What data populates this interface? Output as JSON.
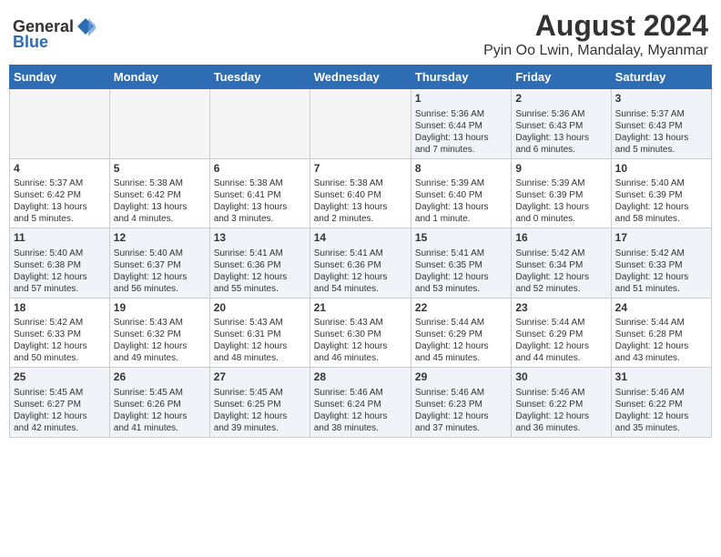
{
  "header": {
    "logo_general": "General",
    "logo_blue": "Blue",
    "main_title": "August 2024",
    "subtitle": "Pyin Oo Lwin, Mandalay, Myanmar"
  },
  "weekdays": [
    "Sunday",
    "Monday",
    "Tuesday",
    "Wednesday",
    "Thursday",
    "Friday",
    "Saturday"
  ],
  "weeks": [
    [
      {
        "day": "",
        "content": ""
      },
      {
        "day": "",
        "content": ""
      },
      {
        "day": "",
        "content": ""
      },
      {
        "day": "",
        "content": ""
      },
      {
        "day": "1",
        "content": "Sunrise: 5:36 AM\nSunset: 6:44 PM\nDaylight: 13 hours\nand 7 minutes."
      },
      {
        "day": "2",
        "content": "Sunrise: 5:36 AM\nSunset: 6:43 PM\nDaylight: 13 hours\nand 6 minutes."
      },
      {
        "day": "3",
        "content": "Sunrise: 5:37 AM\nSunset: 6:43 PM\nDaylight: 13 hours\nand 5 minutes."
      }
    ],
    [
      {
        "day": "4",
        "content": "Sunrise: 5:37 AM\nSunset: 6:42 PM\nDaylight: 13 hours\nand 5 minutes."
      },
      {
        "day": "5",
        "content": "Sunrise: 5:38 AM\nSunset: 6:42 PM\nDaylight: 13 hours\nand 4 minutes."
      },
      {
        "day": "6",
        "content": "Sunrise: 5:38 AM\nSunset: 6:41 PM\nDaylight: 13 hours\nand 3 minutes."
      },
      {
        "day": "7",
        "content": "Sunrise: 5:38 AM\nSunset: 6:40 PM\nDaylight: 13 hours\nand 2 minutes."
      },
      {
        "day": "8",
        "content": "Sunrise: 5:39 AM\nSunset: 6:40 PM\nDaylight: 13 hours\nand 1 minute."
      },
      {
        "day": "9",
        "content": "Sunrise: 5:39 AM\nSunset: 6:39 PM\nDaylight: 13 hours\nand 0 minutes."
      },
      {
        "day": "10",
        "content": "Sunrise: 5:40 AM\nSunset: 6:39 PM\nDaylight: 12 hours\nand 58 minutes."
      }
    ],
    [
      {
        "day": "11",
        "content": "Sunrise: 5:40 AM\nSunset: 6:38 PM\nDaylight: 12 hours\nand 57 minutes."
      },
      {
        "day": "12",
        "content": "Sunrise: 5:40 AM\nSunset: 6:37 PM\nDaylight: 12 hours\nand 56 minutes."
      },
      {
        "day": "13",
        "content": "Sunrise: 5:41 AM\nSunset: 6:36 PM\nDaylight: 12 hours\nand 55 minutes."
      },
      {
        "day": "14",
        "content": "Sunrise: 5:41 AM\nSunset: 6:36 PM\nDaylight: 12 hours\nand 54 minutes."
      },
      {
        "day": "15",
        "content": "Sunrise: 5:41 AM\nSunset: 6:35 PM\nDaylight: 12 hours\nand 53 minutes."
      },
      {
        "day": "16",
        "content": "Sunrise: 5:42 AM\nSunset: 6:34 PM\nDaylight: 12 hours\nand 52 minutes."
      },
      {
        "day": "17",
        "content": "Sunrise: 5:42 AM\nSunset: 6:33 PM\nDaylight: 12 hours\nand 51 minutes."
      }
    ],
    [
      {
        "day": "18",
        "content": "Sunrise: 5:42 AM\nSunset: 6:33 PM\nDaylight: 12 hours\nand 50 minutes."
      },
      {
        "day": "19",
        "content": "Sunrise: 5:43 AM\nSunset: 6:32 PM\nDaylight: 12 hours\nand 49 minutes."
      },
      {
        "day": "20",
        "content": "Sunrise: 5:43 AM\nSunset: 6:31 PM\nDaylight: 12 hours\nand 48 minutes."
      },
      {
        "day": "21",
        "content": "Sunrise: 5:43 AM\nSunset: 6:30 PM\nDaylight: 12 hours\nand 46 minutes."
      },
      {
        "day": "22",
        "content": "Sunrise: 5:44 AM\nSunset: 6:29 PM\nDaylight: 12 hours\nand 45 minutes."
      },
      {
        "day": "23",
        "content": "Sunrise: 5:44 AM\nSunset: 6:29 PM\nDaylight: 12 hours\nand 44 minutes."
      },
      {
        "day": "24",
        "content": "Sunrise: 5:44 AM\nSunset: 6:28 PM\nDaylight: 12 hours\nand 43 minutes."
      }
    ],
    [
      {
        "day": "25",
        "content": "Sunrise: 5:45 AM\nSunset: 6:27 PM\nDaylight: 12 hours\nand 42 minutes."
      },
      {
        "day": "26",
        "content": "Sunrise: 5:45 AM\nSunset: 6:26 PM\nDaylight: 12 hours\nand 41 minutes."
      },
      {
        "day": "27",
        "content": "Sunrise: 5:45 AM\nSunset: 6:25 PM\nDaylight: 12 hours\nand 39 minutes."
      },
      {
        "day": "28",
        "content": "Sunrise: 5:46 AM\nSunset: 6:24 PM\nDaylight: 12 hours\nand 38 minutes."
      },
      {
        "day": "29",
        "content": "Sunrise: 5:46 AM\nSunset: 6:23 PM\nDaylight: 12 hours\nand 37 minutes."
      },
      {
        "day": "30",
        "content": "Sunrise: 5:46 AM\nSunset: 6:22 PM\nDaylight: 12 hours\nand 36 minutes."
      },
      {
        "day": "31",
        "content": "Sunrise: 5:46 AM\nSunset: 6:22 PM\nDaylight: 12 hours\nand 35 minutes."
      }
    ]
  ]
}
